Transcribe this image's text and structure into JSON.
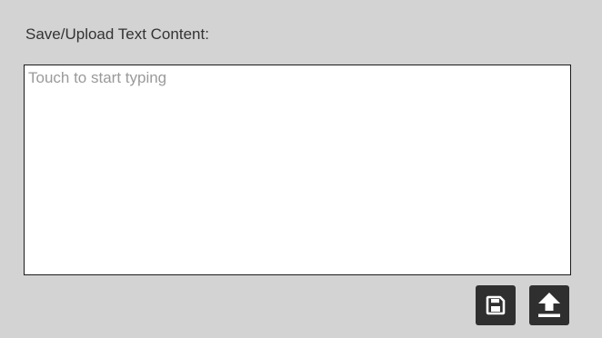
{
  "panel": {
    "title": "Save/Upload Text Content:"
  },
  "editor": {
    "placeholder": "Touch to start typing",
    "value": ""
  },
  "actions": {
    "save_icon": "floppy-disk-icon",
    "upload_icon": "upload-arrow-icon",
    "button_color": "#2f2f2f",
    "icon_color": "#ffffff"
  }
}
